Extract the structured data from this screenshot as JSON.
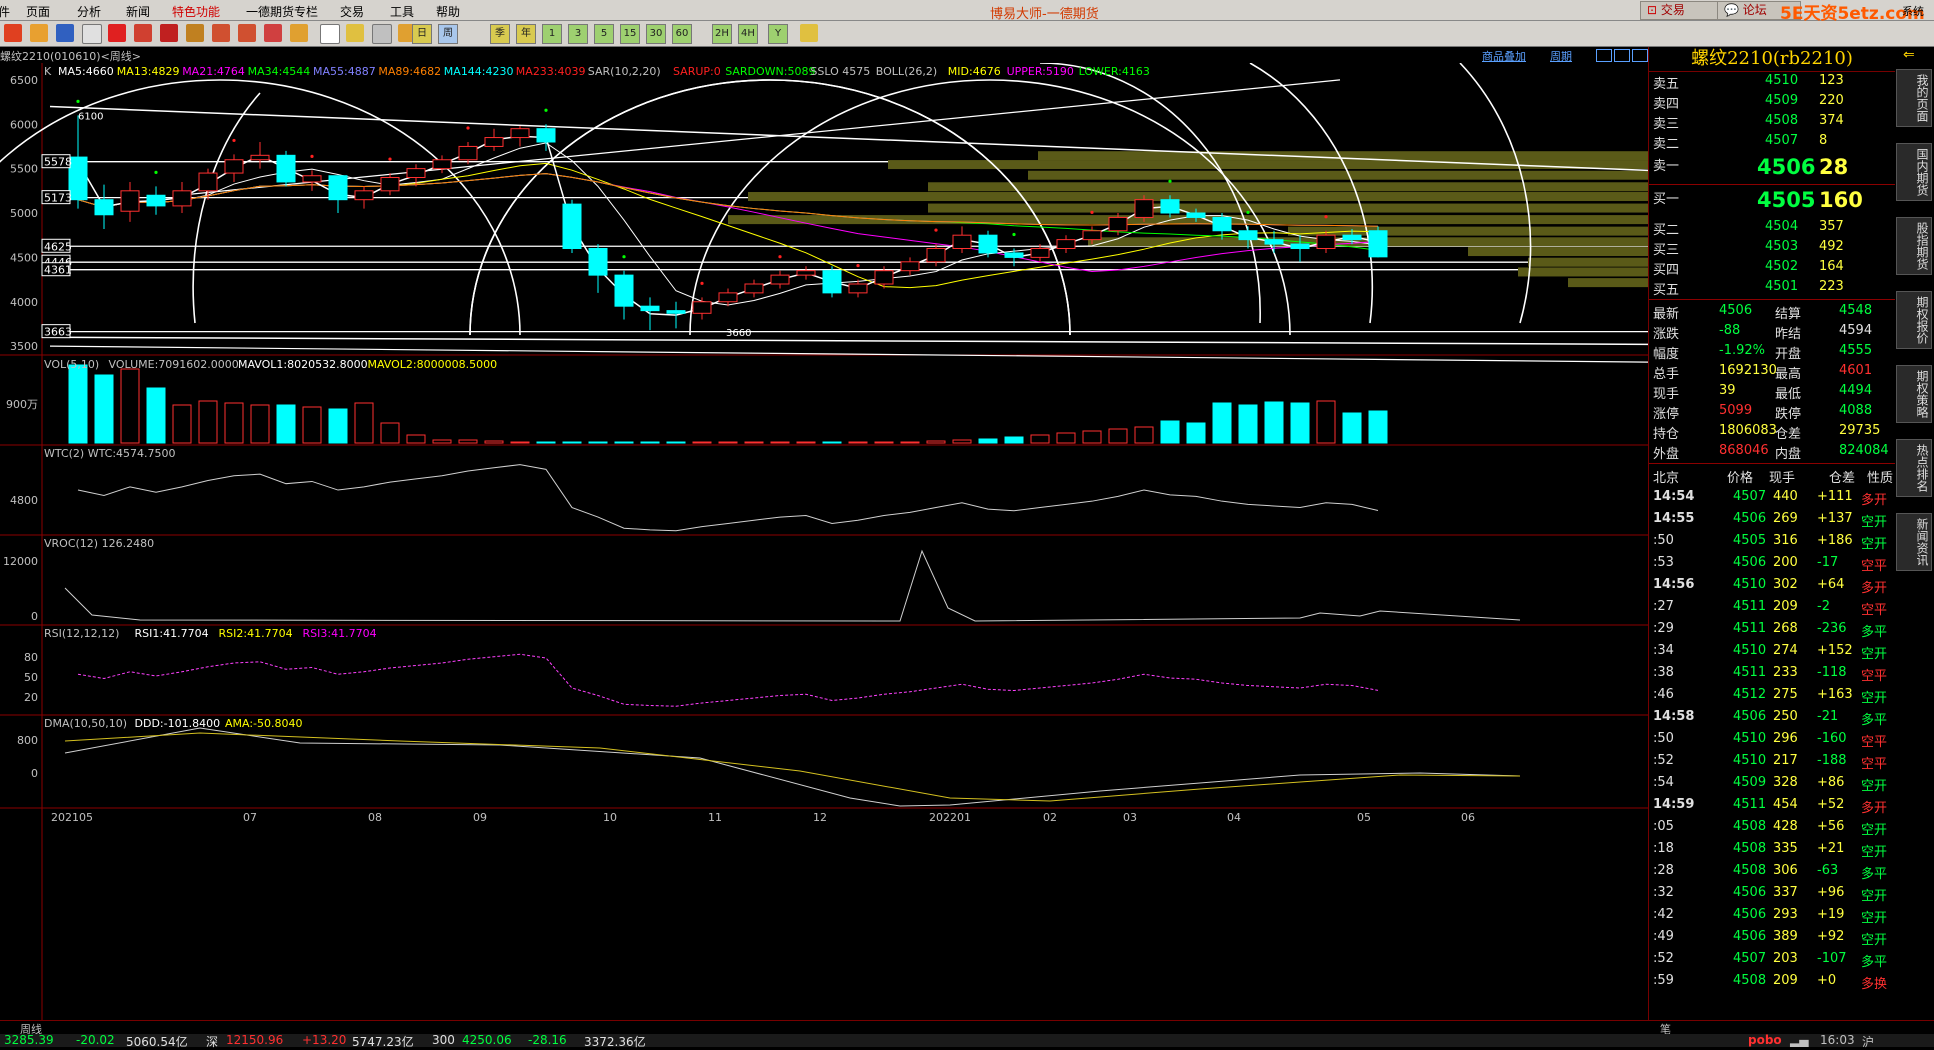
{
  "menu": {
    "items": [
      "件",
      "页面",
      "分析",
      "新闻",
      "特色功能",
      "一德期货专栏",
      "交易",
      "工具",
      "帮助"
    ],
    "title": "博易大师-一德期货",
    "trade_btn": "交易",
    "forum_btn": "论坛",
    "brand": "5E天资5etz.com",
    "system": "系统"
  },
  "toolbar": {
    "digits": [
      "日",
      "周",
      "季",
      "年",
      "1",
      "3",
      "5",
      "15",
      "30",
      "60",
      "2H",
      "4H",
      "Y"
    ]
  },
  "chart": {
    "header_symbol": "螺纹2210(010610)<周线>",
    "header_links": [
      "商品叠加",
      "周期"
    ],
    "k_line_label": "K",
    "ma": [
      {
        "t": "MA5:4660",
        "c": "#ffffff"
      },
      {
        "t": "MA13:4829",
        "c": "#ffff00"
      },
      {
        "t": "MA21:4764",
        "c": "#ff00ff"
      },
      {
        "t": "MA34:4544",
        "c": "#00ff00"
      },
      {
        "t": "MA55:4887",
        "c": "#8080ff"
      },
      {
        "t": "MA89:4682",
        "c": "#ff8000"
      },
      {
        "t": "MA144:4230",
        "c": "#00ffff"
      },
      {
        "t": "MA233:4039",
        "c": "#ff2020"
      },
      {
        "t": "SAR(10,2,20)",
        "c": "#c0c0c0"
      },
      {
        "t": "SARUP:0",
        "c": "#ff2020"
      },
      {
        "t": "SARDOWN:5089",
        "c": "#00ff00"
      },
      {
        "t": "SSLO 4575",
        "c": "#c0c0c0"
      },
      {
        "t": "BOLL(26,2)",
        "c": "#c0c0c0"
      },
      {
        "t": "MID:4676",
        "c": "#ffff00"
      },
      {
        "t": "UPPER:5190",
        "c": "#ff00ff"
      },
      {
        "t": "LOWER:4163",
        "c": "#00ff00"
      }
    ],
    "price_axis": [
      "6500",
      "6000",
      "5500",
      "5000",
      "4500",
      "4000",
      "3500"
    ],
    "price_boxes": [
      "5578",
      "5173",
      "4625",
      "4446",
      "4361",
      "3663"
    ],
    "price_top_label": "6100",
    "price_bottom_label": "3660",
    "vol_header": [
      {
        "t": "VOL(5,10)",
        "c": "#c0c0c0"
      },
      {
        "t": "VOLUME:7091602.0000",
        "c": "#c0c0c0"
      },
      {
        "t": "MAVOL1:8020532.8000",
        "c": "#ffffff"
      },
      {
        "t": "MAVOL2:8000008.5000",
        "c": "#ffff00"
      }
    ],
    "vol_axis": "900万",
    "wtc_header": "WTC(2) WTC:4574.7500",
    "wtc_axis": "4800",
    "vroc_header": "VROC(12) 126.2480",
    "vroc_axis": [
      "12000",
      "0"
    ],
    "rsi_header": [
      {
        "t": "RSI(12,12,12)",
        "c": "#c0c0c0"
      },
      {
        "t": "RSI1:41.7704",
        "c": "#ffffff"
      },
      {
        "t": "RSI2:41.7704",
        "c": "#ffff00"
      },
      {
        "t": "RSI3:41.7704",
        "c": "#ff00ff"
      }
    ],
    "rsi_axis": [
      "80",
      "50",
      "20"
    ],
    "dma_header": [
      {
        "t": "DMA(10,50,10)",
        "c": "#c0c0c0"
      },
      {
        "t": "DDD:-101.8400",
        "c": "#ffffff"
      },
      {
        "t": "AMA:-50.8040",
        "c": "#ffff00"
      }
    ],
    "dma_axis": [
      "800",
      "0"
    ],
    "period_label": "周线",
    "time_axis": [
      "202105",
      "07",
      "08",
      "09",
      "10",
      "11",
      "12",
      "202201",
      "02",
      "03",
      "04",
      "05",
      "06"
    ]
  },
  "chart_data": {
    "type": "candlestick",
    "period": "weekly",
    "symbol": "螺纹2210",
    "ylim": [
      3400,
      6600
    ],
    "candles": [
      {
        "o": 5630,
        "h": 6100,
        "l": 5050,
        "c": 5150
      },
      {
        "o": 5150,
        "h": 5320,
        "l": 4820,
        "c": 4980
      },
      {
        "o": 5020,
        "h": 5350,
        "l": 4900,
        "c": 5250
      },
      {
        "o": 5200,
        "h": 5300,
        "l": 4980,
        "c": 5080
      },
      {
        "o": 5080,
        "h": 5350,
        "l": 5000,
        "c": 5250
      },
      {
        "o": 5250,
        "h": 5500,
        "l": 5150,
        "c": 5450
      },
      {
        "o": 5450,
        "h": 5660,
        "l": 5350,
        "c": 5600
      },
      {
        "o": 5600,
        "h": 5800,
        "l": 5500,
        "c": 5650
      },
      {
        "o": 5650,
        "h": 5700,
        "l": 5300,
        "c": 5350
      },
      {
        "o": 5350,
        "h": 5480,
        "l": 5250,
        "c": 5420
      },
      {
        "o": 5420,
        "h": 5420,
        "l": 5000,
        "c": 5150
      },
      {
        "o": 5150,
        "h": 5300,
        "l": 5050,
        "c": 5250
      },
      {
        "o": 5250,
        "h": 5450,
        "l": 5200,
        "c": 5400
      },
      {
        "o": 5400,
        "h": 5550,
        "l": 5300,
        "c": 5500
      },
      {
        "o": 5500,
        "h": 5650,
        "l": 5450,
        "c": 5600
      },
      {
        "o": 5600,
        "h": 5800,
        "l": 5550,
        "c": 5750
      },
      {
        "o": 5750,
        "h": 5950,
        "l": 5700,
        "c": 5850
      },
      {
        "o": 5850,
        "h": 5980,
        "l": 5750,
        "c": 5950
      },
      {
        "o": 5950,
        "h": 6000,
        "l": 5700,
        "c": 5800
      },
      {
        "o": 5100,
        "h": 5150,
        "l": 4550,
        "c": 4600
      },
      {
        "o": 4600,
        "h": 4650,
        "l": 4100,
        "c": 4300
      },
      {
        "o": 4300,
        "h": 4350,
        "l": 3800,
        "c": 3950
      },
      {
        "o": 3950,
        "h": 4050,
        "l": 3680,
        "c": 3900
      },
      {
        "o": 3900,
        "h": 4000,
        "l": 3700,
        "c": 3870
      },
      {
        "o": 3870,
        "h": 4050,
        "l": 3800,
        "c": 4000
      },
      {
        "o": 4000,
        "h": 4150,
        "l": 3950,
        "c": 4100
      },
      {
        "o": 4100,
        "h": 4250,
        "l": 4050,
        "c": 4200
      },
      {
        "o": 4200,
        "h": 4350,
        "l": 4150,
        "c": 4300
      },
      {
        "o": 4300,
        "h": 4400,
        "l": 4250,
        "c": 4350
      },
      {
        "o": 4350,
        "h": 4400,
        "l": 4050,
        "c": 4100
      },
      {
        "o": 4100,
        "h": 4250,
        "l": 4050,
        "c": 4200
      },
      {
        "o": 4200,
        "h": 4400,
        "l": 4150,
        "c": 4350
      },
      {
        "o": 4350,
        "h": 4500,
        "l": 4300,
        "c": 4450
      },
      {
        "o": 4450,
        "h": 4650,
        "l": 4400,
        "c": 4600
      },
      {
        "o": 4600,
        "h": 4850,
        "l": 4550,
        "c": 4750
      },
      {
        "o": 4750,
        "h": 4800,
        "l": 4500,
        "c": 4550
      },
      {
        "o": 4550,
        "h": 4600,
        "l": 4400,
        "c": 4500
      },
      {
        "o": 4500,
        "h": 4650,
        "l": 4450,
        "c": 4600
      },
      {
        "o": 4600,
        "h": 4750,
        "l": 4550,
        "c": 4700
      },
      {
        "o": 4700,
        "h": 4850,
        "l": 4650,
        "c": 4800
      },
      {
        "o": 4800,
        "h": 5000,
        "l": 4750,
        "c": 4950
      },
      {
        "o": 4950,
        "h": 5200,
        "l": 4900,
        "c": 5150
      },
      {
        "o": 5150,
        "h": 5200,
        "l": 4950,
        "c": 5000
      },
      {
        "o": 5000,
        "h": 5050,
        "l": 4900,
        "c": 4950
      },
      {
        "o": 4950,
        "h": 5000,
        "l": 4700,
        "c": 4800
      },
      {
        "o": 4800,
        "h": 4850,
        "l": 4600,
        "c": 4700
      },
      {
        "o": 4700,
        "h": 4800,
        "l": 4550,
        "c": 4650
      },
      {
        "o": 4650,
        "h": 4750,
        "l": 4450,
        "c": 4600
      },
      {
        "o": 4600,
        "h": 4800,
        "l": 4550,
        "c": 4750
      },
      {
        "o": 4750,
        "h": 4820,
        "l": 4650,
        "c": 4700
      },
      {
        "o": 4800,
        "h": 4850,
        "l": 4500,
        "c": 4506
      }
    ],
    "volume_tail_scale": "900万"
  },
  "quote": {
    "symbol": "螺纹2210(rb2210)",
    "asks": [
      {
        "l": "卖五",
        "p": "4510",
        "v": "123"
      },
      {
        "l": "卖四",
        "p": "4509",
        "v": "220"
      },
      {
        "l": "卖三",
        "p": "4508",
        "v": "374"
      },
      {
        "l": "卖二",
        "p": "4507",
        "v": "8"
      }
    ],
    "ask1": {
      "l": "卖一",
      "p": "4506",
      "v": "28"
    },
    "bid1": {
      "l": "买一",
      "p": "4505",
      "v": "160"
    },
    "bids": [
      {
        "l": "买二",
        "p": "4504",
        "v": "357"
      },
      {
        "l": "买三",
        "p": "4503",
        "v": "492"
      },
      {
        "l": "买四",
        "p": "4502",
        "v": "164"
      },
      {
        "l": "买五",
        "p": "4501",
        "v": "223"
      }
    ],
    "stats": [
      {
        "a": "最新",
        "b": "4506",
        "bc": "c-g",
        "c": "结算",
        "d": "4548",
        "dc": "c-g"
      },
      {
        "a": "涨跌",
        "b": "-88",
        "bc": "c-g",
        "c": "昨结",
        "d": "4594",
        "dc": "c-w"
      },
      {
        "a": "幅度",
        "b": "-1.92%",
        "bc": "c-g",
        "c": "开盘",
        "d": "4555",
        "dc": "c-g"
      },
      {
        "a": "总手",
        "b": "1692130",
        "bc": "c-y",
        "c": "最高",
        "d": "4601",
        "dc": "c-r"
      },
      {
        "a": "现手",
        "b": "39",
        "bc": "c-y",
        "c": "最低",
        "d": "4494",
        "dc": "c-g"
      },
      {
        "a": "涨停",
        "b": "5099",
        "bc": "c-r",
        "c": "跌停",
        "d": "4088",
        "dc": "c-g"
      },
      {
        "a": "持仓",
        "b": "1806083",
        "bc": "c-y",
        "c": "仓差",
        "d": "29735",
        "dc": "c-y"
      },
      {
        "a": "外盘",
        "b": "868046",
        "bc": "c-r",
        "c": "内盘",
        "d": "824084",
        "dc": "c-g"
      }
    ],
    "ticks_header": [
      "北京",
      "价格",
      "现手",
      "仓差",
      "性质"
    ],
    "ticks": [
      {
        "t": "14:54",
        "tb": true,
        "p": "4507",
        "v": "440",
        "d": "+111",
        "n": "多开",
        "nc": "c-r"
      },
      {
        "t": "14:55",
        "tb": true,
        "p": "4506",
        "v": "269",
        "d": "+137",
        "n": "空开",
        "nc": "c-g"
      },
      {
        "t": ":50",
        "tb": false,
        "p": "4505",
        "v": "316",
        "d": "+186",
        "n": "空开",
        "nc": "c-g"
      },
      {
        "t": ":53",
        "tb": false,
        "p": "4506",
        "v": "200",
        "d": "-17",
        "n": "空平",
        "nc": "c-r"
      },
      {
        "t": "14:56",
        "tb": true,
        "p": "4510",
        "v": "302",
        "d": "+64",
        "n": "多开",
        "nc": "c-r"
      },
      {
        "t": ":27",
        "tb": false,
        "p": "4511",
        "v": "209",
        "d": "-2",
        "n": "空平",
        "nc": "c-r"
      },
      {
        "t": ":29",
        "tb": false,
        "p": "4511",
        "v": "268",
        "d": "-236",
        "n": "多平",
        "nc": "c-g"
      },
      {
        "t": ":34",
        "tb": false,
        "p": "4510",
        "v": "274",
        "d": "+152",
        "n": "空开",
        "nc": "c-g"
      },
      {
        "t": ":38",
        "tb": false,
        "p": "4511",
        "v": "233",
        "d": "-118",
        "n": "空平",
        "nc": "c-r"
      },
      {
        "t": ":46",
        "tb": false,
        "p": "4512",
        "v": "275",
        "d": "+163",
        "n": "空开",
        "nc": "c-g"
      },
      {
        "t": "14:58",
        "tb": true,
        "p": "4506",
        "v": "250",
        "d": "-21",
        "n": "多平",
        "nc": "c-g"
      },
      {
        "t": ":50",
        "tb": false,
        "p": "4510",
        "v": "296",
        "d": "-160",
        "n": "空平",
        "nc": "c-r"
      },
      {
        "t": ":52",
        "tb": false,
        "p": "4510",
        "v": "217",
        "d": "-188",
        "n": "空平",
        "nc": "c-r"
      },
      {
        "t": ":54",
        "tb": false,
        "p": "4509",
        "v": "328",
        "d": "+86",
        "n": "空开",
        "nc": "c-g"
      },
      {
        "t": "14:59",
        "tb": true,
        "p": "4511",
        "v": "454",
        "d": "+52",
        "n": "多开",
        "nc": "c-r"
      },
      {
        "t": ":05",
        "tb": false,
        "p": "4508",
        "v": "428",
        "d": "+56",
        "n": "空开",
        "nc": "c-g"
      },
      {
        "t": ":18",
        "tb": false,
        "p": "4508",
        "v": "335",
        "d": "+21",
        "n": "空开",
        "nc": "c-g"
      },
      {
        "t": ":28",
        "tb": false,
        "p": "4508",
        "v": "306",
        "d": "-63",
        "n": "多平",
        "nc": "c-g"
      },
      {
        "t": ":32",
        "tb": false,
        "p": "4506",
        "v": "337",
        "d": "+96",
        "n": "空开",
        "nc": "c-g"
      },
      {
        "t": ":42",
        "tb": false,
        "p": "4506",
        "v": "293",
        "d": "+19",
        "n": "空开",
        "nc": "c-g"
      },
      {
        "t": ":49",
        "tb": false,
        "p": "4506",
        "v": "389",
        "d": "+92",
        "n": "空开",
        "nc": "c-g"
      },
      {
        "t": ":52",
        "tb": false,
        "p": "4507",
        "v": "203",
        "d": "-107",
        "n": "多平",
        "nc": "c-g"
      },
      {
        "t": ":59",
        "tb": false,
        "p": "4508",
        "v": "209",
        "d": "+0",
        "n": "多换",
        "nc": "c-r"
      }
    ],
    "tab": "笔"
  },
  "sidetabs": [
    "我的页面",
    "国内期货",
    "股指期货",
    "期权报价",
    "期权策略",
    "热点排名",
    "新闻资讯"
  ],
  "bottom": {
    "idx1": "3285.39",
    "chg1": "-20.02",
    "amt1": "5060.54亿",
    "name2": "深",
    "idx2": "12150.96",
    "chg2": "+13.20",
    "amt2": "5747.23亿",
    "name3": "300",
    "idx3": "4250.06",
    "chg3": "-28.16",
    "amt3": "3372.36亿",
    "pobo": "pobo",
    "time": "16:03",
    "name4": "沪"
  }
}
